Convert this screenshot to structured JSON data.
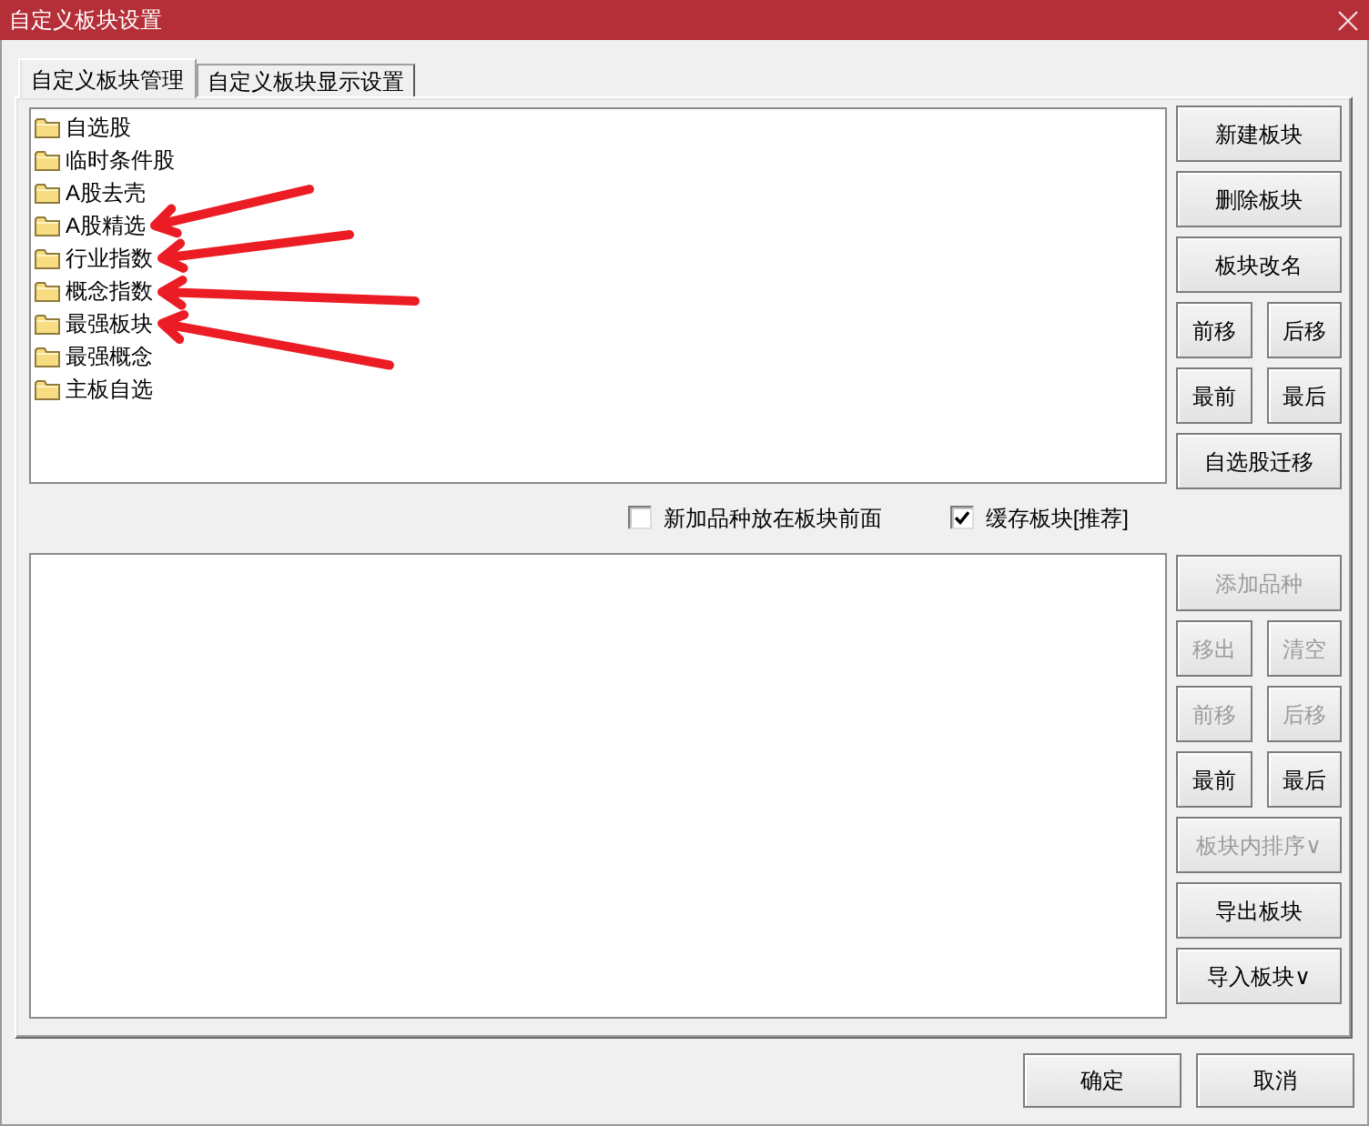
{
  "window": {
    "title": "自定义板块设置"
  },
  "tabs": [
    {
      "label": "自定义板块管理",
      "selected": true
    },
    {
      "label": "自定义板块显示设置",
      "selected": false
    }
  ],
  "block_list": {
    "items": [
      {
        "label": "自选股",
        "marked_by_arrow": false
      },
      {
        "label": "临时条件股",
        "marked_by_arrow": false
      },
      {
        "label": "A股去壳",
        "marked_by_arrow": false
      },
      {
        "label": "A股精选",
        "marked_by_arrow": true
      },
      {
        "label": "行业指数",
        "marked_by_arrow": true
      },
      {
        "label": "概念指数",
        "marked_by_arrow": true
      },
      {
        "label": "最强板块",
        "marked_by_arrow": true
      },
      {
        "label": "最强概念",
        "marked_by_arrow": false
      },
      {
        "label": "主板自选",
        "marked_by_arrow": false
      }
    ]
  },
  "block_buttons": [
    {
      "buttons": [
        {
          "label": "新建板块",
          "disabled": false
        }
      ]
    },
    {
      "buttons": [
        {
          "label": "删除板块",
          "disabled": false
        }
      ]
    },
    {
      "buttons": [
        {
          "label": "板块改名",
          "disabled": false
        }
      ]
    },
    {
      "buttons": [
        {
          "label": "前移",
          "disabled": false
        },
        {
          "label": "后移",
          "disabled": false
        }
      ]
    },
    {
      "buttons": [
        {
          "label": "最前",
          "disabled": false
        },
        {
          "label": "最后",
          "disabled": false
        }
      ]
    },
    {
      "buttons": [
        {
          "label": "自选股迁移",
          "disabled": false
        }
      ]
    }
  ],
  "options": [
    {
      "label": "新加品种放在板块前面",
      "checked": false
    },
    {
      "label": "缓存板块[推荐]",
      "checked": true
    }
  ],
  "stock_buttons": [
    {
      "buttons": [
        {
          "label": "添加品种",
          "disabled": true
        }
      ]
    },
    {
      "buttons": [
        {
          "label": "移出",
          "disabled": true
        },
        {
          "label": "清空",
          "disabled": true
        }
      ]
    },
    {
      "buttons": [
        {
          "label": "前移",
          "disabled": true
        },
        {
          "label": "后移",
          "disabled": true
        }
      ]
    },
    {
      "buttons": [
        {
          "label": "最前",
          "disabled": false
        },
        {
          "label": "最后",
          "disabled": false
        }
      ]
    },
    {
      "buttons": [
        {
          "label": "板块内排序∨",
          "disabled": true
        }
      ]
    },
    {
      "buttons": [
        {
          "label": "导出板块",
          "disabled": false
        }
      ]
    },
    {
      "buttons": [
        {
          "label": "导入板块∨",
          "disabled": false
        }
      ]
    }
  ],
  "footer_buttons": [
    {
      "label": "确定"
    },
    {
      "label": "取消"
    }
  ]
}
